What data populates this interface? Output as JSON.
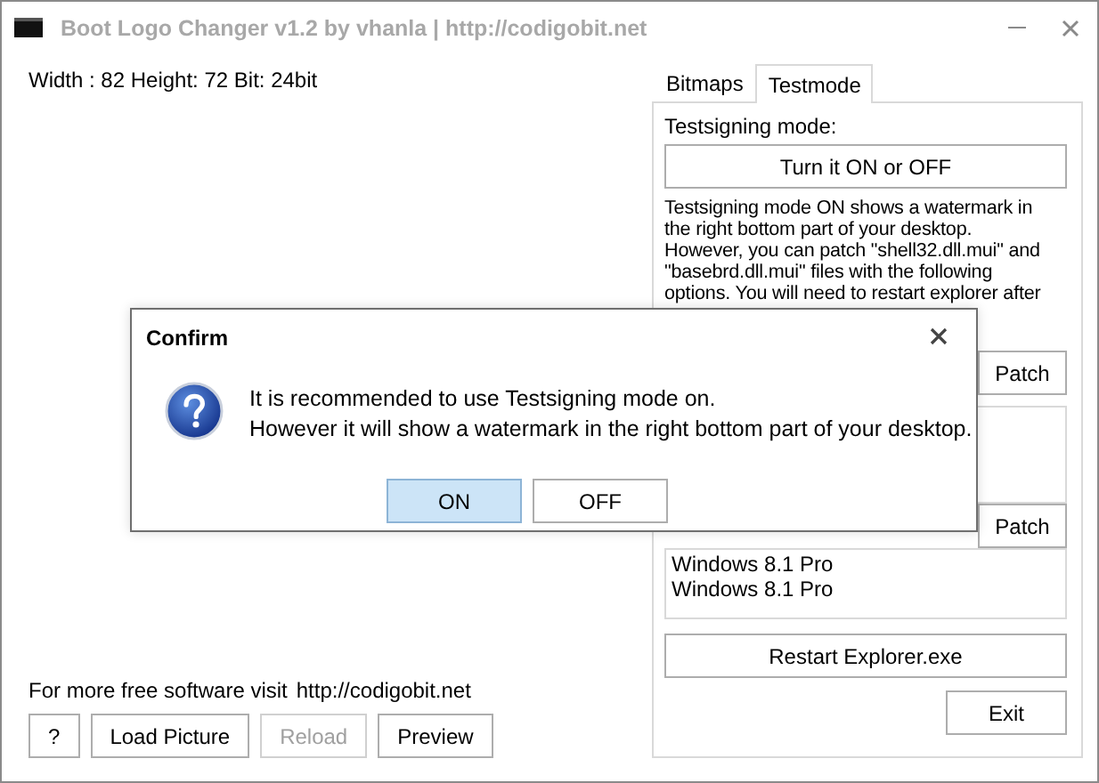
{
  "window": {
    "title": "Boot Logo Changer v1.2 by vhanla | http://codigobit.net"
  },
  "image_info": "Width : 82 Height: 72 Bit: 24bit",
  "footer": {
    "text": "For more free software visit",
    "link": "http://codigobit.net"
  },
  "buttons": [
    {
      "label": "?",
      "disabled": false
    },
    {
      "label": "Load Picture",
      "disabled": false
    },
    {
      "label": "Reload",
      "disabled": true
    },
    {
      "label": "Preview",
      "disabled": false
    }
  ],
  "tabs": [
    {
      "label": "Bitmaps",
      "selected": false
    },
    {
      "label": "Testmode",
      "selected": true
    }
  ],
  "testmode": {
    "label": "Testsigning mode:",
    "toggle_button": "Turn it ON or OFF",
    "description_lines": [
      "Testsigning mode ON shows a watermark in",
      "the right bottom part of your desktop.",
      "However,  you can patch \"shell32.dll.mui\" and",
      "\"basebrd.dll.mui\" files with the following",
      "options. You will need to restart explorer after"
    ],
    "patch_buttons": [
      "Patch",
      "Patch"
    ],
    "editions": [
      "Windows 8.1 Pro",
      "Windows 8.1 Pro"
    ],
    "restart_button": "Restart Explorer.exe",
    "exit_button": "Exit"
  },
  "dialog": {
    "title": "Confirm",
    "message_lines": [
      "It is recommended to use Testsigning mode on.",
      "However it will show a watermark in the right bottom part of your desktop."
    ],
    "buttons": [
      {
        "label": "ON",
        "selected": true
      },
      {
        "label": "OFF",
        "selected": false
      }
    ]
  }
}
